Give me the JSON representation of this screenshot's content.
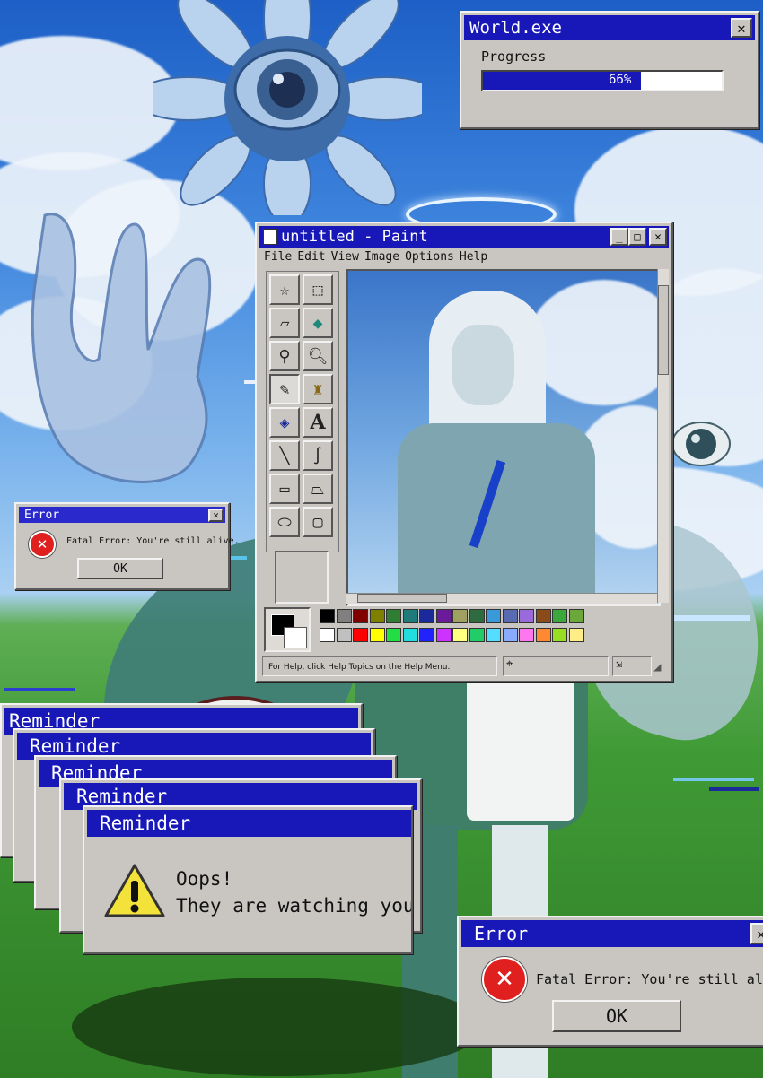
{
  "world_window": {
    "title": "World.exe",
    "progress_label": "Progress",
    "progress_value": 0.66,
    "progress_text": "66%"
  },
  "paint_window": {
    "title": "untitled - Paint",
    "menu": [
      "File",
      "Edit",
      "View",
      "Image",
      "Options",
      "Help"
    ],
    "tools": [
      "free-select-icon",
      "rect-select-icon",
      "eraser-icon",
      "fill-icon",
      "color-picker-icon",
      "magnifier-icon",
      "pencil-icon",
      "brush-icon",
      "airbrush-icon",
      "text-icon",
      "line-icon",
      "curve-icon",
      "rectangle-icon",
      "polygon-icon",
      "ellipse-icon",
      "rounded-rect-icon"
    ],
    "text_tool_glyph": "A",
    "status_text": "For Help, click Help Topics on the Help Menu.",
    "palette_top": [
      "#000000",
      "#808080",
      "#800000",
      "#808000",
      "#2e7d32",
      "#1f7a7a",
      "#1a2a9a",
      "#6a1b9a",
      "#a0a060",
      "#2e6b3e",
      "#3a9ad9",
      "#5a6ab0",
      "#9a6adb",
      "#8a4a1a",
      "#3aa83a",
      "#6aa83a"
    ],
    "palette_bottom": [
      "#ffffff",
      "#c0c0c0",
      "#ff0000",
      "#ffff00",
      "#22dd44",
      "#22dddd",
      "#2222ff",
      "#cc33ff",
      "#ffff80",
      "#22cc66",
      "#55ddff",
      "#88aaff",
      "#ff77ee",
      "#ff8833",
      "#99dd22",
      "#ffee88"
    ],
    "foreground_color": "#000000",
    "background_color": "#ffffff"
  },
  "small_error": {
    "title": "Error",
    "message": "Fatal Error: You're still alive.",
    "ok_label": "OK"
  },
  "large_error": {
    "title": "Error",
    "message": "Fatal Error: You're still alive.",
    "ok_label": "OK"
  },
  "reminders": {
    "stack_titles": [
      "Reminder",
      "Reminder",
      "Reminder",
      "Reminder"
    ],
    "front_title": "Reminder",
    "line1": "Oops!",
    "line2": "They are watching you"
  },
  "colors": {
    "titlebar": "#1818b8",
    "window_face": "#c9c6c2",
    "error_red": "#e0201e",
    "warning_yellow": "#f2e23a"
  }
}
